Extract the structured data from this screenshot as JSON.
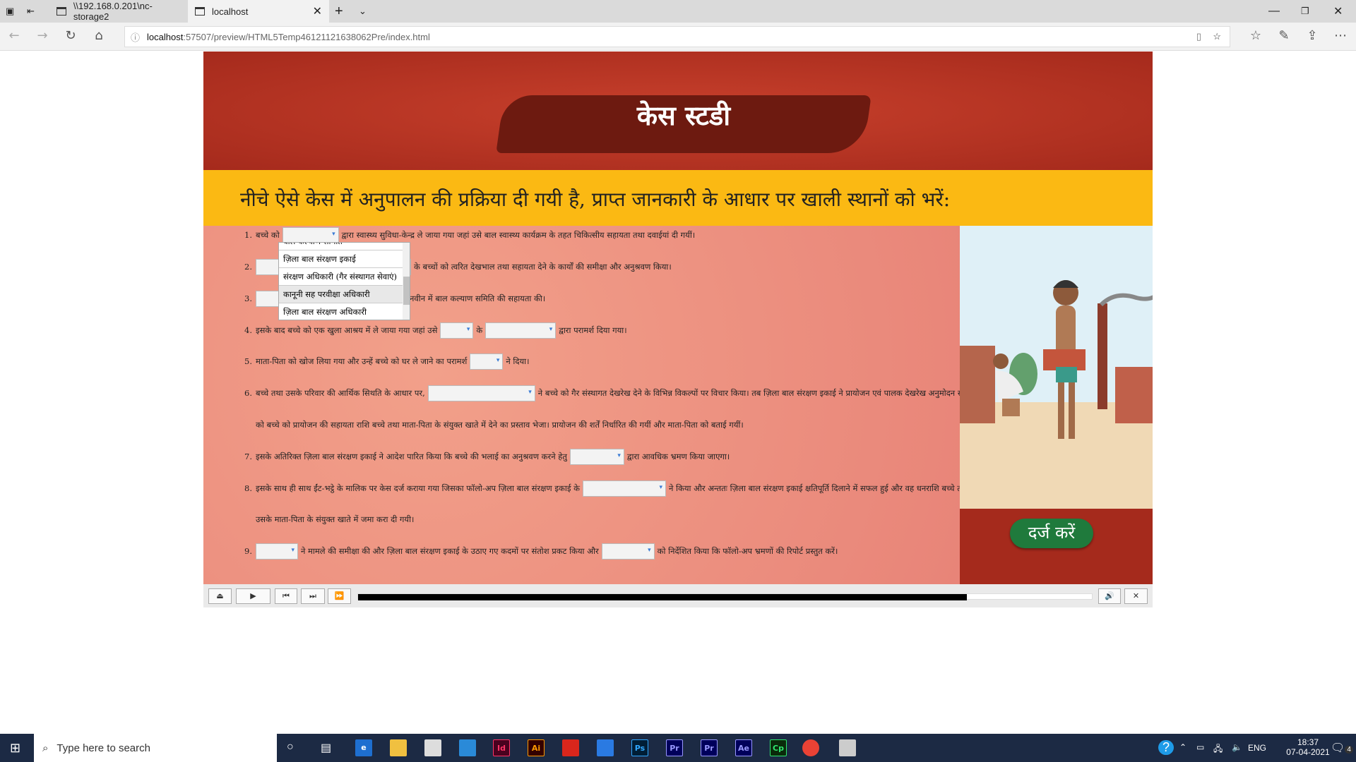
{
  "browser": {
    "tabs": [
      {
        "label": "\\\\192.168.0.201\\nc-storage2"
      },
      {
        "label": "localhost"
      }
    ],
    "url_host": "localhost",
    "url_rest": ":57507/preview/HTML5Temp46121121638062Pre/index.html"
  },
  "page": {
    "title": "केस स्टडी",
    "instruction": "नीचे ऐसे केस में अनुपालन की प्रक्रिया दी गयी है, प्राप्त जानकारी के आधार पर खाली स्थानों को भरें:",
    "items": [
      {
        "num": "1.",
        "parts": [
          "बच्चे को",
          "द्वारा स्वास्थ्य सुविधा-केन्द्र ले जाया गया जहां उसे बाल स्वास्थ्य कार्यक्रम के तहत चिकित्सीय सहायता तथा दवाईयां दी गयीं।"
        ]
      },
      {
        "num": "2.",
        "parts": [
          "",
          "के बच्चों को त्वरित देखभाल तथा सहायता देने के कार्यों की समीक्षा और अनुश्रवण किया।"
        ]
      },
      {
        "num": "3.",
        "parts": [
          "",
          "नवीन में बाल कल्याण समिति की सहायता की।"
        ]
      },
      {
        "num": "4.",
        "parts": [
          "इसके बाद बच्चे को एक खुला आश्रय में ले जाया गया जहां उसे",
          "के",
          "द्वारा परामर्श दिया गया।"
        ]
      },
      {
        "num": "5.",
        "parts": [
          "माता-पिता को खोज लिया गया और उन्हें बच्चे को घर ले जाने का परामर्श",
          "ने दिया।"
        ]
      },
      {
        "num": "6.",
        "parts": [
          "बच्चे तथा उसके परिवार की आर्थिक सिथति के आधार पर,",
          "ने बच्चे को गैर संस्थागत देखरेख देने के विभिन्न विकल्पों पर विचार किया। तब ज़िला बाल संरक्षण इकाई ने प्रायोजन एवं पालक देखरेख अनुमोदन समिति",
          "को बच्चे को प्रायोजन की सहायता राशि बच्चे तथा माता-पिता के संयुक्त खाते में देने का प्रस्ताव भेजा। प्रायोजन की शर्तें निर्धारित की गयीं और माता-पिता को बताई गयीं।"
        ]
      },
      {
        "num": "7.",
        "parts": [
          "इसके अतिरिक्त ज़िला बाल संरक्षण इकाई ने आदेश पारित किया कि बच्चे की भलाई का अनुश्रवण करने हेतु",
          "द्वारा आवधिक भ्रमण किया जाएगा।"
        ]
      },
      {
        "num": "8.",
        "parts": [
          "इसके साथ ही साथ ईंट-भट्ठे के मालिक पर केस दर्ज कराया गया जिसका फॉलो-अप ज़िला बाल संरक्षण इकाई के",
          "ने किया और अन्ततः ज़िला बाल संरक्षण इकाई क्षतिपूर्ति दिलाने में सफल हुई और वह धनराशि बच्चे तथा",
          "उसके माता-पिता के संयुक्त खाते में जमा करा दी गयी।"
        ]
      },
      {
        "num": "9.",
        "parts": [
          "",
          "ने मामले की समीक्षा की और ज़िला बाल संरक्षण इकाई के उठाए गए कदमों पर संतोश प्रकट किया और",
          "को निर्देशित किया कि फॉलो-अप भ्रमणों की रिपोर्ट प्रस्तुत करें।"
        ]
      }
    ],
    "dropdown_options": [
      "बाल कल्याण समिति",
      "ज़िला बाल संरक्षण इकाई",
      "संरक्षण अधिकारी (गैर संस्थागत सेवाएं)",
      "कानूनी सह परवीक्षा अधिकारी",
      "ज़िला बाल संरक्षण अधिकारी"
    ],
    "dropdown_highlighted": "कानूनी सह परवीक्षा अधिकारी",
    "submit_label": "दर्ज करें",
    "progress_percent": 83
  },
  "player": {
    "buttons": [
      "exit-icon",
      "play-icon",
      "previous-icon",
      "next-icon",
      "fast-forward-icon",
      "volume-icon",
      "close-icon"
    ],
    "glyphs": [
      "⏏",
      "▶",
      "⏮",
      "⏭",
      "⏩",
      "🔊",
      "✕"
    ]
  },
  "taskbar": {
    "search_placeholder": "Type here to search",
    "apps": [
      {
        "label": "Id",
        "color": "#49021f",
        "fg": "#ff3366"
      },
      {
        "label": "Ai",
        "color": "#330000",
        "fg": "#ff9a00"
      },
      {
        "label": "Ps",
        "color": "#001e36",
        "fg": "#31a8ff"
      },
      {
        "label": "Pr",
        "color": "#00005b",
        "fg": "#9999ff"
      },
      {
        "label": "Pr",
        "color": "#00005b",
        "fg": "#9999ff"
      },
      {
        "label": "Ae",
        "color": "#00005b",
        "fg": "#9999ff"
      },
      {
        "label": "Cp",
        "color": "#0a2a0a",
        "fg": "#2fe66f"
      }
    ],
    "lang": "ENG",
    "time": "18:37",
    "date": "07-04-2021",
    "notifications": "4"
  }
}
